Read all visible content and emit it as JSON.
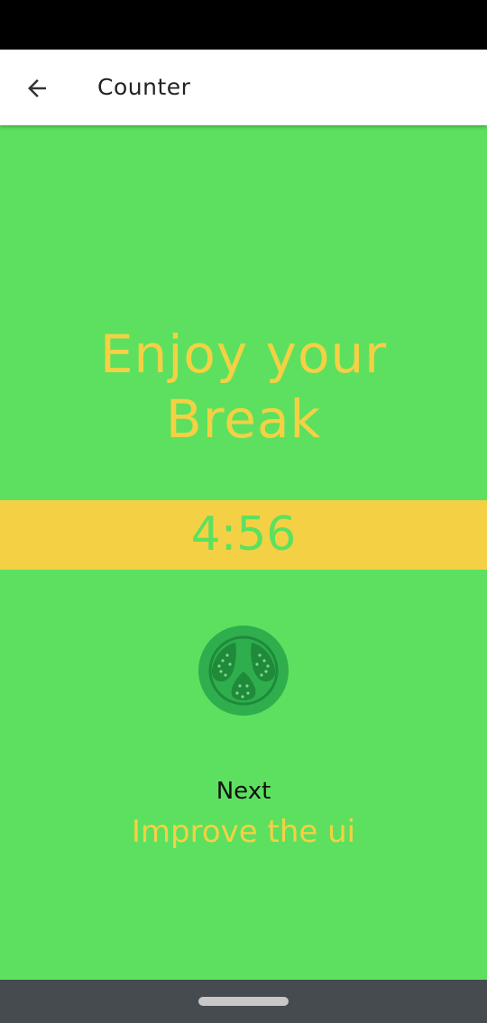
{
  "app_bar": {
    "back_icon": "arrow-back-icon",
    "title": "Counter"
  },
  "main": {
    "headline_line1": "Enjoy your",
    "headline_line2": "Break",
    "timer": "4:56",
    "tomato_icon": "tomato-icon",
    "next_label": "Next",
    "next_task": "Improve the ui"
  },
  "colors": {
    "background": "#5de05f",
    "accent_yellow": "#f4d144",
    "tomato_outer": "#2fae4d",
    "tomato_inner": "#1f8a3a",
    "app_bar": "#ffffff",
    "nav_bar": "#454b4f"
  }
}
